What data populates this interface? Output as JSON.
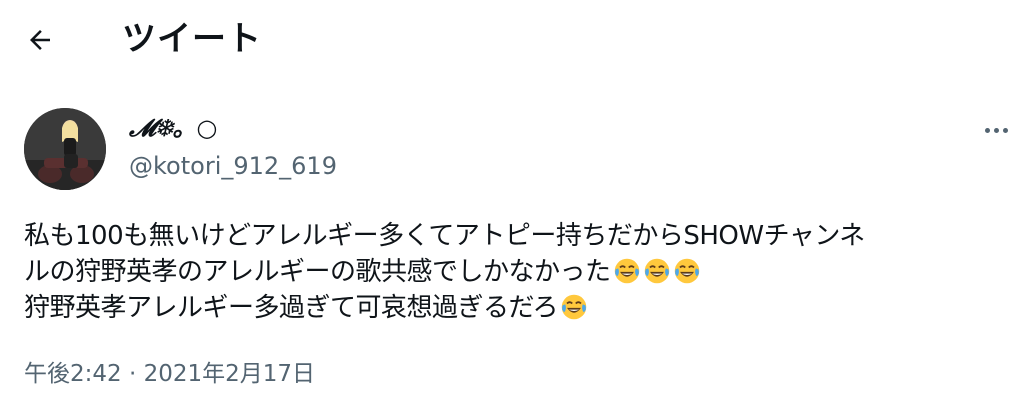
{
  "header": {
    "back_icon": "arrow-left-icon",
    "title": "ツイート"
  },
  "author": {
    "display_name": "𝓜❄。○",
    "handle": "@kotori_912_619"
  },
  "tweet": {
    "line1": "私も100も無いけどアレルギー多くてアトピー持ちだからSHOWチャンネ",
    "line2": "ルの狩野英孝のアレルギーの歌共感でしかなかった",
    "line3": "狩野英孝アレルギー多過ぎて可哀想過ぎるだろ",
    "emoji_name": "face-with-tears-of-joy-icon"
  },
  "meta": {
    "time": "午後2:42",
    "separator": "·",
    "date": "2021年2月17日"
  },
  "colors": {
    "text": "#0f1419",
    "secondary": "#536471",
    "emoji_face": "#ffc83d",
    "emoji_tears": "#4fa8e8"
  }
}
